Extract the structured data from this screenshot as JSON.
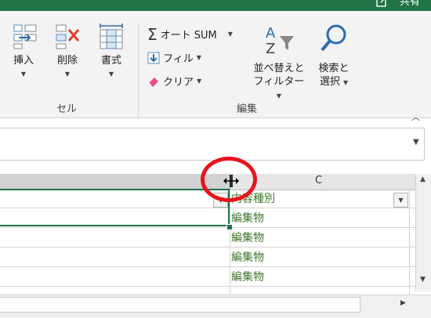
{
  "share_label": "共有",
  "ribbon": {
    "cells_group": {
      "label": "セル",
      "insert": "挿入",
      "delete": "削除",
      "format": "書式"
    },
    "edit_group": {
      "label": "編集",
      "autosum": "オート SUM",
      "fill": "フィル",
      "clear": "クリア",
      "sort_filter_line1": "並べ替えと",
      "sort_filter_line2": "フィルター",
      "find_select_line1": "検索と",
      "find_select_line2": "選択"
    }
  },
  "grid": {
    "column_c_header": "C",
    "header_cell": "内容種別",
    "rows": [
      "編集物",
      "編集物",
      "編集物",
      "編集物"
    ]
  },
  "colors": {
    "accent": "#217346",
    "cell_text": "#3e7a2a",
    "highlight_circle": "#e8141c"
  }
}
